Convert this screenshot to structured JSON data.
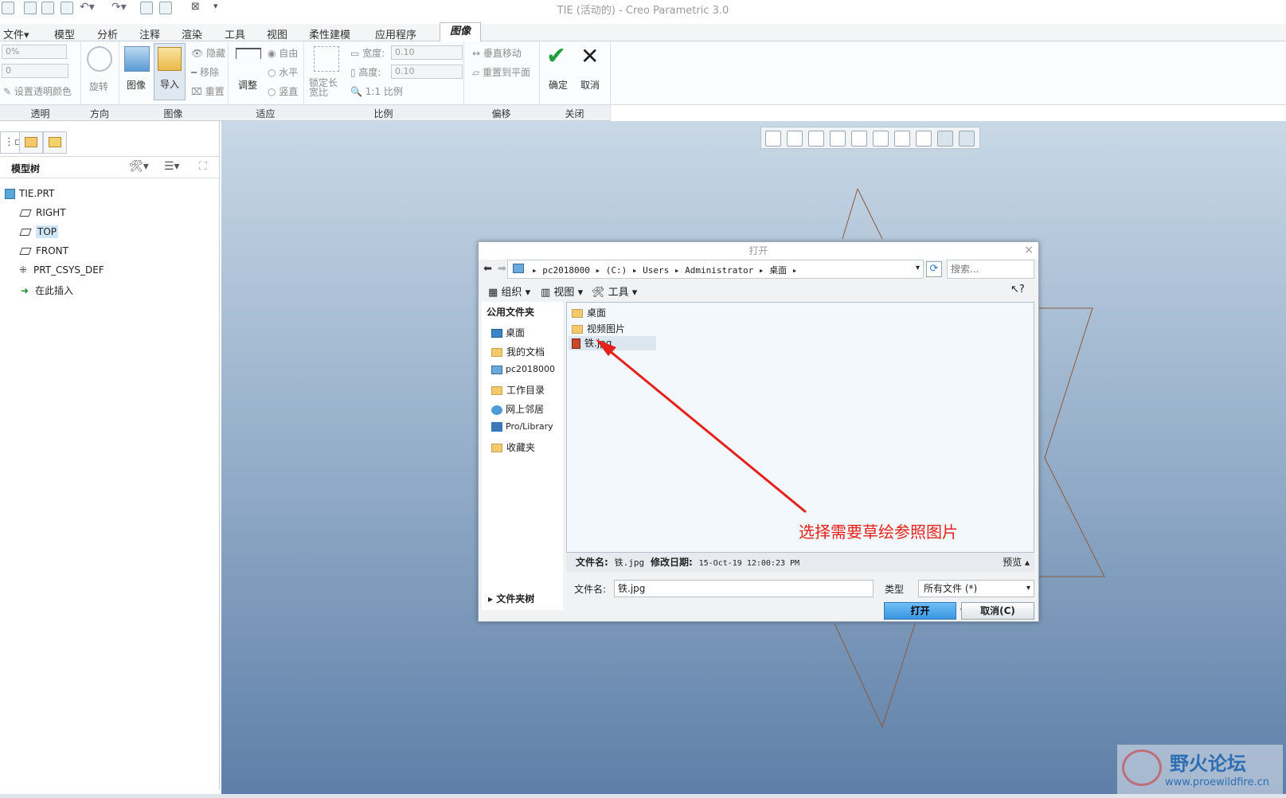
{
  "window": {
    "title": "TIE (活动的) - Creo Parametric 3.0"
  },
  "menu_tabs": [
    "文件",
    "模型",
    "分析",
    "注释",
    "渲染",
    "工具",
    "视图",
    "柔性建模",
    "应用程序"
  ],
  "active_tab": "图像",
  "ribbon": {
    "transparency": {
      "value": "0%",
      "value2": "0",
      "set_color": "设置透明颜色"
    },
    "rotate": "旋转",
    "image": "图像",
    "import": "导入",
    "hide": "隐藏",
    "remove": "移除",
    "reset": "重置",
    "adjust": "调整",
    "free": "自由",
    "horizontal": "水平",
    "vertical": "竖直",
    "lock_ratio": "锁定长宽比",
    "width_label": "宽度:",
    "width_value": "0.10",
    "height_label": "高度:",
    "height_value": "0.10",
    "scale_label": "1:1 比例",
    "move_vertical": "垂直移动",
    "reset_to_plane": "重置到平面",
    "ok": "确定",
    "cancel": "取消"
  },
  "groups": [
    "透明",
    "方向",
    "图像",
    "适应",
    "比例",
    "偏移",
    "关闭"
  ],
  "model_tree": {
    "title": "模型树",
    "items": [
      {
        "label": "TIE.PRT",
        "icon": "part-icon"
      },
      {
        "label": "RIGHT",
        "icon": "datum-plane-icon"
      },
      {
        "label": "TOP",
        "icon": "datum-plane-icon",
        "selected": true
      },
      {
        "label": "FRONT",
        "icon": "datum-plane-icon"
      },
      {
        "label": "PRT_CSYS_DEF",
        "icon": "csys-icon"
      },
      {
        "label": "在此插入",
        "icon": "insert-arrow-icon"
      }
    ]
  },
  "dialog": {
    "title": "打开",
    "breadcrumb": [
      "pc2018000",
      "(C:)",
      "Users",
      "Administrator",
      "桌面"
    ],
    "search_placeholder": "搜索...",
    "toolbar": {
      "organize": "组织",
      "view": "视图",
      "tools": "工具",
      "help": "?"
    },
    "places_title": "公用文件夹",
    "places": [
      "桌面",
      "我的文档",
      "pc2018000",
      "工作目录",
      "网上邻居",
      "Pro/Library",
      "收藏夹"
    ],
    "files": [
      {
        "name": "桌面",
        "type": "folder"
      },
      {
        "name": "视频图片",
        "type": "folder"
      },
      {
        "name": "铁.jpg",
        "type": "jpg",
        "selected": true
      }
    ],
    "info": {
      "filename_label": "文件名:",
      "filename": "铁.jpg",
      "date_label": "修改日期:",
      "date": "15-Oct-19 12:00:23 PM",
      "preview": "预览"
    },
    "filename_label": "文件名:",
    "filename_value": "铁.jpg",
    "type_label": "类型",
    "type_value": "所有文件 (*)",
    "folder_tree": "文件夹树",
    "open_button": "打开",
    "cancel_button": "取消(C)"
  },
  "annotation": "选择需要草绘参照图片",
  "watermark": {
    "name": "野火论坛",
    "url": "www.proewildfire.cn"
  },
  "colors": {
    "accent": "#3b95e0",
    "annotation": "#e4221b",
    "sketch_line": "#8b5a3c"
  }
}
